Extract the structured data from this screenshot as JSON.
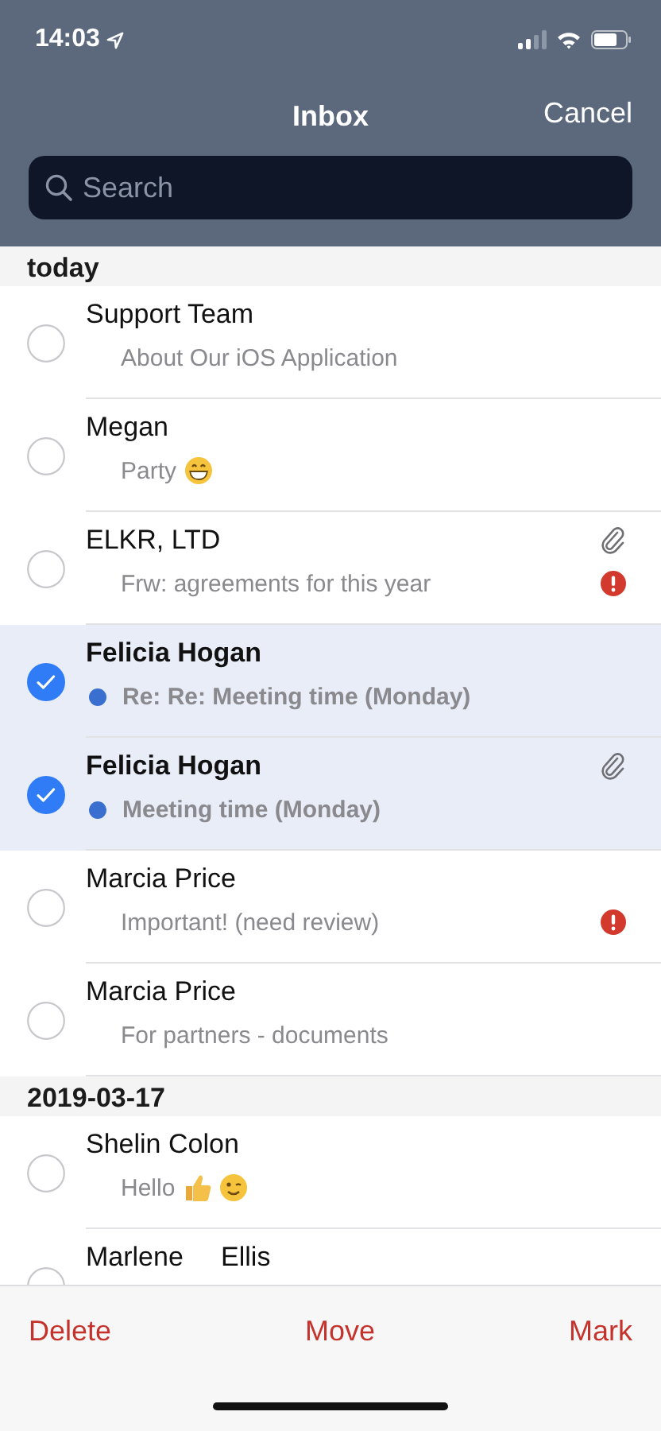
{
  "status_bar": {
    "time": "14:03"
  },
  "nav": {
    "title": "Inbox",
    "action": "Cancel"
  },
  "search": {
    "placeholder": "Search"
  },
  "sections": [
    {
      "title": "today",
      "messages": [
        {
          "sender": "Support Team",
          "subject": "About Our iOS Application",
          "selected": false,
          "unread": false,
          "attachment": false,
          "important": false
        },
        {
          "sender": "Megan",
          "subject": "Party",
          "emoji": [
            {
              "kind": "grin"
            }
          ],
          "selected": false,
          "unread": false,
          "attachment": false,
          "important": false
        },
        {
          "sender": "ELKR, LTD",
          "subject": "Frw: agreements for this year",
          "selected": false,
          "unread": false,
          "attachment": true,
          "important": true
        },
        {
          "sender": "Felicia Hogan",
          "subject": "Re: Re: Meeting time (Monday)",
          "selected": true,
          "unread": true,
          "attachment": false,
          "important": false
        },
        {
          "sender": "Felicia Hogan",
          "subject": "Meeting time (Monday)",
          "selected": true,
          "unread": true,
          "attachment": true,
          "important": false
        },
        {
          "sender": "Marcia Price",
          "subject": "Important! (need review)",
          "selected": false,
          "unread": false,
          "attachment": false,
          "important": true
        },
        {
          "sender": "Marcia Price",
          "subject": "For partners - documents",
          "selected": false,
          "unread": false,
          "attachment": false,
          "important": false
        }
      ]
    },
    {
      "title": "2019-03-17",
      "messages": [
        {
          "sender": "Shelin Colon",
          "subject": "Hello",
          "emoji": [
            {
              "kind": "thumbs-up"
            },
            {
              "kind": "wink"
            }
          ],
          "selected": false,
          "unread": false,
          "attachment": false,
          "important": false
        },
        {
          "sender": "Marlene     Ellis",
          "selected": false,
          "unread": false,
          "attachment": false,
          "important": false
        }
      ]
    }
  ],
  "toolbar": [
    {
      "label": "Delete"
    },
    {
      "label": "Move"
    },
    {
      "label": "Mark"
    }
  ]
}
